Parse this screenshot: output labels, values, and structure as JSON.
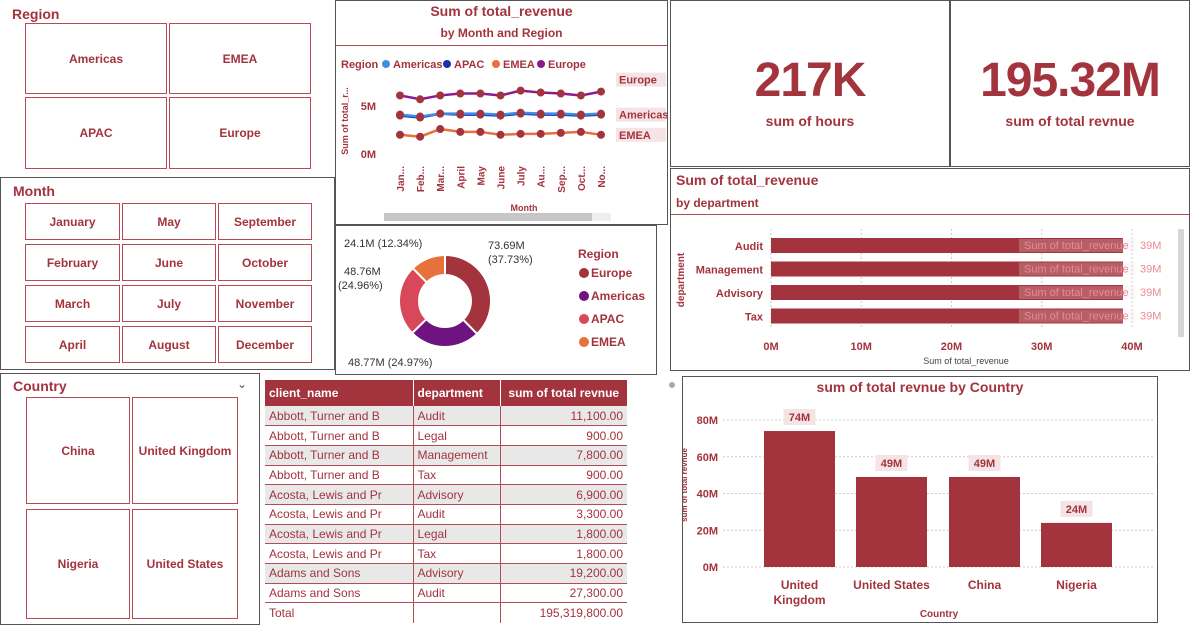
{
  "region_slicer": {
    "title": "Region",
    "items": [
      "Americas",
      "EMEA",
      "APAC",
      "Europe"
    ]
  },
  "month_slicer": {
    "title": "Month",
    "items": [
      "January",
      "May",
      "September",
      "February",
      "June",
      "October",
      "March",
      "July",
      "November",
      "April",
      "August",
      "December"
    ]
  },
  "country_slicer": {
    "title": "Country",
    "items": [
      "China",
      "United Kingdom",
      "Nigeria",
      "United States"
    ]
  },
  "kpis": [
    {
      "value": "217K",
      "label": "sum of hours"
    },
    {
      "value": "195.32M",
      "label": "sum of total revnue"
    }
  ],
  "colors": {
    "brand": "#a3333d",
    "americas": "#1f2fae",
    "apac": "#3b8ee4",
    "emea": "#e8703a",
    "europe": "#8b1a8f",
    "bar": "#a3333d"
  },
  "line_chart": {
    "title": "Sum of total_revenue",
    "subtitle": "by Month and Region",
    "legend_title": "Region",
    "legend": [
      "Americas",
      "APAC",
      "EMEA",
      "Europe"
    ],
    "ylabel": "Sum of total_r...",
    "xlabel": "Month",
    "y_ticks": [
      "5M",
      "0M"
    ],
    "x_ticks": [
      "Jan...",
      "Feb...",
      "Mar...",
      "April",
      "May",
      "June",
      "July",
      "Au...",
      "Sep...",
      "Oct...",
      "No..."
    ],
    "end_labels": [
      "Europe",
      "Americas",
      "EMEA"
    ]
  },
  "donut": {
    "legend_title": "Region",
    "legend": [
      "Europe",
      "Americas",
      "APAC",
      "EMEA"
    ],
    "labels": [
      "73.69M",
      "(37.73%)",
      "48.77M (24.97%)",
      "48.76M",
      "(24.96%)",
      "24.1M (12.34%)"
    ]
  },
  "dept_chart": {
    "title": "Sum of total_revenue",
    "subtitle": "by department",
    "ylabel": "department",
    "xlabel": "Sum of total_revenue",
    "x_ticks": [
      "0M",
      "10M",
      "20M",
      "30M",
      "40M"
    ],
    "tooltip_label": "Sum of total_revenue",
    "value_label": "39M"
  },
  "table": {
    "headers": [
      "client_name",
      "department",
      "sum of total revnue"
    ],
    "rows": [
      [
        "Abbott, Turner and B",
        "Audit",
        "11,100.00"
      ],
      [
        "Abbott, Turner and B",
        "Legal",
        "900.00"
      ],
      [
        "Abbott, Turner and B",
        "Management",
        "7,800.00"
      ],
      [
        "Abbott, Turner and B",
        "Tax",
        "900.00"
      ],
      [
        "Acosta, Lewis and Pr",
        "Advisory",
        "6,900.00"
      ],
      [
        "Acosta, Lewis and Pr",
        "Audit",
        "3,300.00"
      ],
      [
        "Acosta, Lewis and Pr",
        "Legal",
        "1,800.00"
      ],
      [
        "Acosta, Lewis and Pr",
        "Tax",
        "1,800.00"
      ],
      [
        "Adams and Sons",
        "Advisory",
        "19,200.00"
      ],
      [
        "Adams and Sons",
        "Audit",
        "27,300.00"
      ]
    ],
    "total_label": "Total",
    "total_value": "195,319,800.00"
  },
  "country_chart": {
    "title": "sum of total revnue by Country",
    "ylabel": "sum of total revnue",
    "xlabel": "Country",
    "y_ticks": [
      "80M",
      "60M",
      "40M",
      "20M",
      "0M"
    ],
    "category_lines": [
      [
        "United",
        "Kingdom"
      ],
      [
        "United States"
      ],
      [
        "China"
      ],
      [
        "Nigeria"
      ]
    ],
    "data_labels": [
      "74M",
      "49M",
      "49M",
      "24M"
    ]
  },
  "chart_data": [
    {
      "type": "line",
      "title": "Sum of total_revenue",
      "subtitle": "by Month and Region",
      "xlabel": "Month",
      "ylabel": "Sum of total_r...",
      "x": [
        "Jan...",
        "Feb...",
        "Mar...",
        "April",
        "May",
        "June",
        "July",
        "Au...",
        "Sep...",
        "Oct...",
        "No..."
      ],
      "y_ticks": [
        "0M",
        "5M"
      ],
      "ylim": [
        0,
        7.5
      ],
      "series": [
        {
          "name": "Europe",
          "values": [
            6.1,
            5.7,
            6.1,
            6.3,
            6.3,
            6.1,
            6.6,
            6.4,
            6.3,
            6.1,
            6.5
          ]
        },
        {
          "name": "Americas",
          "values": [
            4.0,
            3.8,
            4.2,
            4.1,
            4.1,
            4.0,
            4.2,
            4.1,
            4.1,
            4.0,
            4.1
          ]
        },
        {
          "name": "EMEA",
          "values": [
            2.0,
            1.8,
            2.6,
            2.3,
            2.3,
            2.0,
            2.1,
            2.1,
            2.2,
            2.3,
            2.0
          ]
        },
        {
          "name": "APAC",
          "values": [
            4.1,
            3.9,
            4.2,
            4.2,
            4.2,
            4.1,
            4.3,
            4.2,
            4.2,
            4.1,
            4.2
          ]
        }
      ],
      "legend_position": "top",
      "grid": false
    },
    {
      "type": "pie",
      "categories": [
        "Europe",
        "Americas",
        "APAC",
        "EMEA"
      ],
      "values": [
        73.69,
        48.77,
        48.76,
        24.1
      ],
      "percent": [
        37.73,
        24.97,
        24.96,
        12.34
      ],
      "legend_position": "right"
    },
    {
      "type": "bar",
      "title": "Sum of total_revenue",
      "subtitle": "by department",
      "orientation": "horizontal",
      "categories": [
        "Audit",
        "Management",
        "Advisory",
        "Tax"
      ],
      "values": [
        39,
        39,
        39,
        39
      ],
      "xlabel": "Sum of total_revenue",
      "ylabel": "department",
      "xlim": [
        0,
        40
      ],
      "grid": true
    },
    {
      "type": "bar",
      "title": "sum of total revnue by Country",
      "categories": [
        "United Kingdom",
        "United States",
        "China",
        "Nigeria"
      ],
      "values": [
        74,
        49,
        49,
        24
      ],
      "xlabel": "Country",
      "ylabel": "sum of total revnue",
      "ylim": [
        0,
        80
      ],
      "grid": true
    }
  ]
}
